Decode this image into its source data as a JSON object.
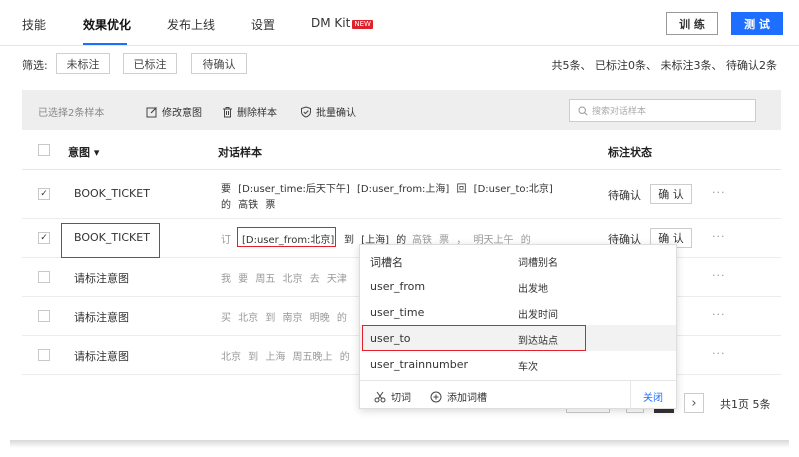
{
  "nav": {
    "tabs": [
      "技能",
      "效果优化",
      "发布上线",
      "设置",
      "DM Kit"
    ],
    "new_badge": "NEW",
    "train_label": "训 练",
    "test_label": "测 试"
  },
  "filter": {
    "label": "筛选:",
    "chips": [
      "未标注",
      "已标注",
      "待确认"
    ],
    "summary": "共5条、 已标注0条、 未标注3条、 待确认2条"
  },
  "toolbar": {
    "selected": "已选择2条样本",
    "edit_intent": "修改意图",
    "delete_samples": "删除样本",
    "batch_confirm": "批量确认",
    "search_placeholder": "搜索对话样本"
  },
  "table": {
    "headers": {
      "intent": "意图 ▾",
      "sample": "对话样本",
      "status": "标注状态"
    },
    "rows": [
      {
        "intent": "BOOK_TICKET",
        "sample_line1": "要  [D:user_time:后天下午]  [D:user_from:上海]  回  [D:user_to:北京]",
        "sample_line2": "的  高铁  票",
        "status": "待确认",
        "confirm": "确 认",
        "more": "···"
      },
      {
        "intent": "BOOK_TICKET",
        "sample_prefix": "订",
        "sample_slot": "[D:user_from:北京]",
        "sample_mid": "到 [上海] 的",
        "sample_rest": "高铁  票  ，  明天上午  的",
        "status": "待确认",
        "confirm": "确 认",
        "more": "···"
      },
      {
        "intent": "请标注意图",
        "sample": "我  要  周五  北京  去  天津",
        "more": "···"
      },
      {
        "intent": "请标注意图",
        "sample": "买  北京  到  南京  明晚  的",
        "more": "···"
      },
      {
        "intent": "请标注意图",
        "sample": "北京  到  上海  周五晚上  的",
        "more": "···"
      }
    ]
  },
  "popup": {
    "col1": "词槽名",
    "col2": "词槽别名",
    "items": [
      {
        "name": "user_from",
        "alias": "出发地"
      },
      {
        "name": "user_time",
        "alias": "出发时间"
      },
      {
        "name": "user_to",
        "alias": "到达站点"
      },
      {
        "name": "user_trainnumber",
        "alias": "车次"
      }
    ],
    "cut": "切词",
    "add_slot": "添加词槽",
    "close": "关闭"
  },
  "pager": {
    "next": "›",
    "summary": "共1页  5条"
  }
}
